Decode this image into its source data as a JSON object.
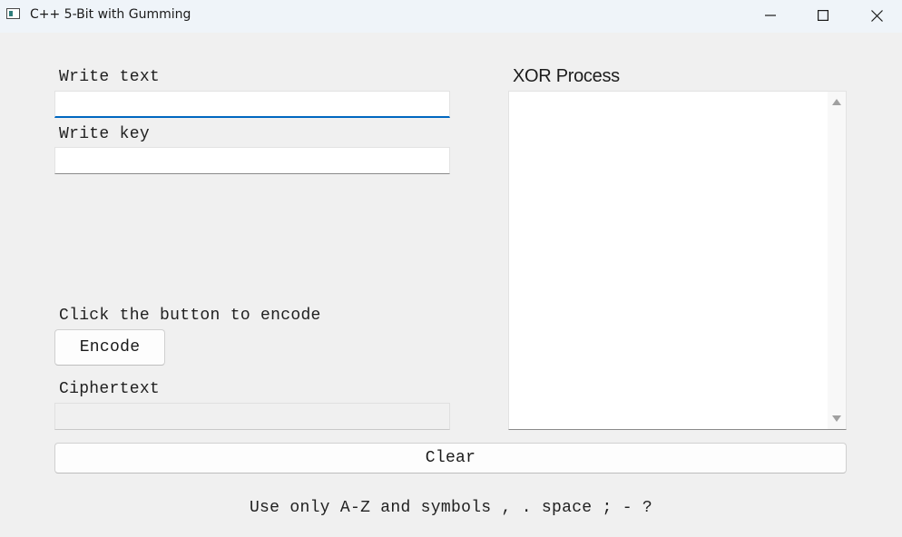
{
  "window": {
    "title": "C++ 5-Bit with Gumming",
    "icons": [
      "app-window-icon",
      "minimize-icon",
      "maximize-icon",
      "close-icon"
    ]
  },
  "form": {
    "text_label": "Write text",
    "text_value": "",
    "key_label": "Write key",
    "key_value": "",
    "encode_prompt": "Click the button to encode",
    "encode_button": "Encode",
    "ciphertext_label": "Ciphertext",
    "ciphertext_value": ""
  },
  "xor": {
    "label": "XOR Process",
    "content": ""
  },
  "actions": {
    "clear_button": "Clear"
  },
  "hint": "Use only A-Z and symbols , . space ; - ?",
  "colors": {
    "background": "#f0f0f0",
    "titlebar": "#eff4f9",
    "focus_accent": "#0067c0"
  }
}
